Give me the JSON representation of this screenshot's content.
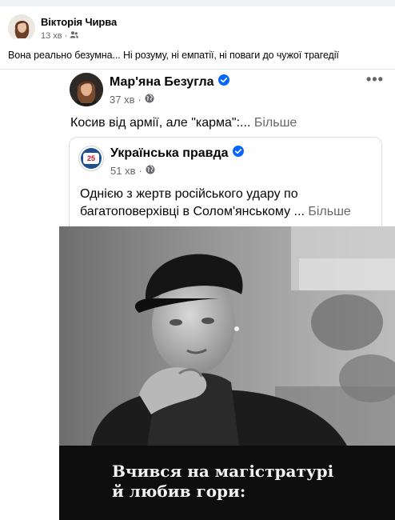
{
  "outer_post": {
    "author": "Вікторія Чирва",
    "time": "13 хв",
    "separator": "·",
    "audience_icon": "friends-icon",
    "text": "Вона реально безумна... Ні розуму, ні емпатії, ні поваги до чужої трагедії"
  },
  "shared_post": {
    "author": "Мар'яна Безугла",
    "verified_icon": "verified-badge-icon",
    "time": "37 хв",
    "separator": "·",
    "audience_icon": "globe-icon",
    "more_icon": "•••",
    "text": "Косив від армії, але \"карма\":...",
    "more_label": " Більше"
  },
  "inner_post": {
    "author": "Українська правда",
    "logo_text": "25",
    "verified_icon": "verified-badge-icon",
    "time": "51 хв",
    "separator": "·",
    "audience_icon": "globe-icon",
    "text_line1": "Однією з жертв російського удару по",
    "text_line2": "багатоповерхівці в Солом'янському ...",
    "more_label": " Більше"
  },
  "photo": {
    "caption_line1": "Вчився на магістратурі",
    "caption_line2": "й любив гори:"
  },
  "colors": {
    "verified": "#0866ff",
    "secondary_text": "#65676b",
    "caption_band": "#0e0e0e"
  }
}
